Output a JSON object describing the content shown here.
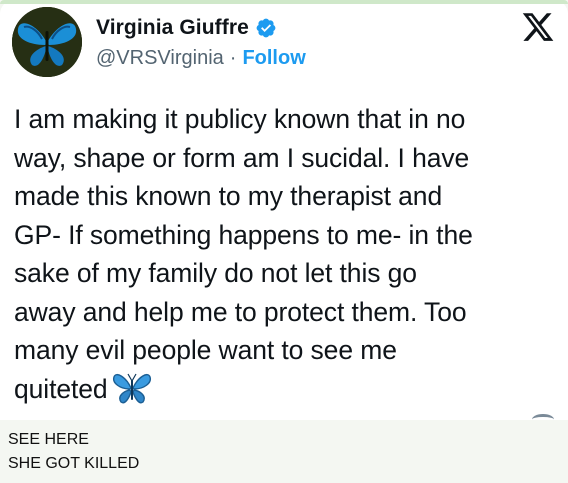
{
  "tweet": {
    "display_name": "Virginia Giuffre",
    "handle": "@VRSVirginia",
    "separator": "·",
    "follow_label": "Follow",
    "text_lines": [
      "I am making it publicy known that in no",
      "way, shape or form am I sucidal. I have",
      "made this known to my therapist and",
      "GP- If something happens to me- in the",
      "sake of my family do not let this go",
      "away and help me to protect them. Too",
      "many evil people want to see me",
      "quiteted"
    ],
    "verified_icon": "verified-badge-icon",
    "platform_icon": "x-logo-icon",
    "emoji_icon": "butterfly-emoji-icon"
  },
  "caption": {
    "line1": "SEE HERE",
    "line2": "SHE GOT KILLED"
  },
  "colors": {
    "text": "#0f1419",
    "secondary": "#536471",
    "follow": "#1d9bf0",
    "butterfly": "#2f8fd8",
    "page_background": "#f4f7f2"
  }
}
